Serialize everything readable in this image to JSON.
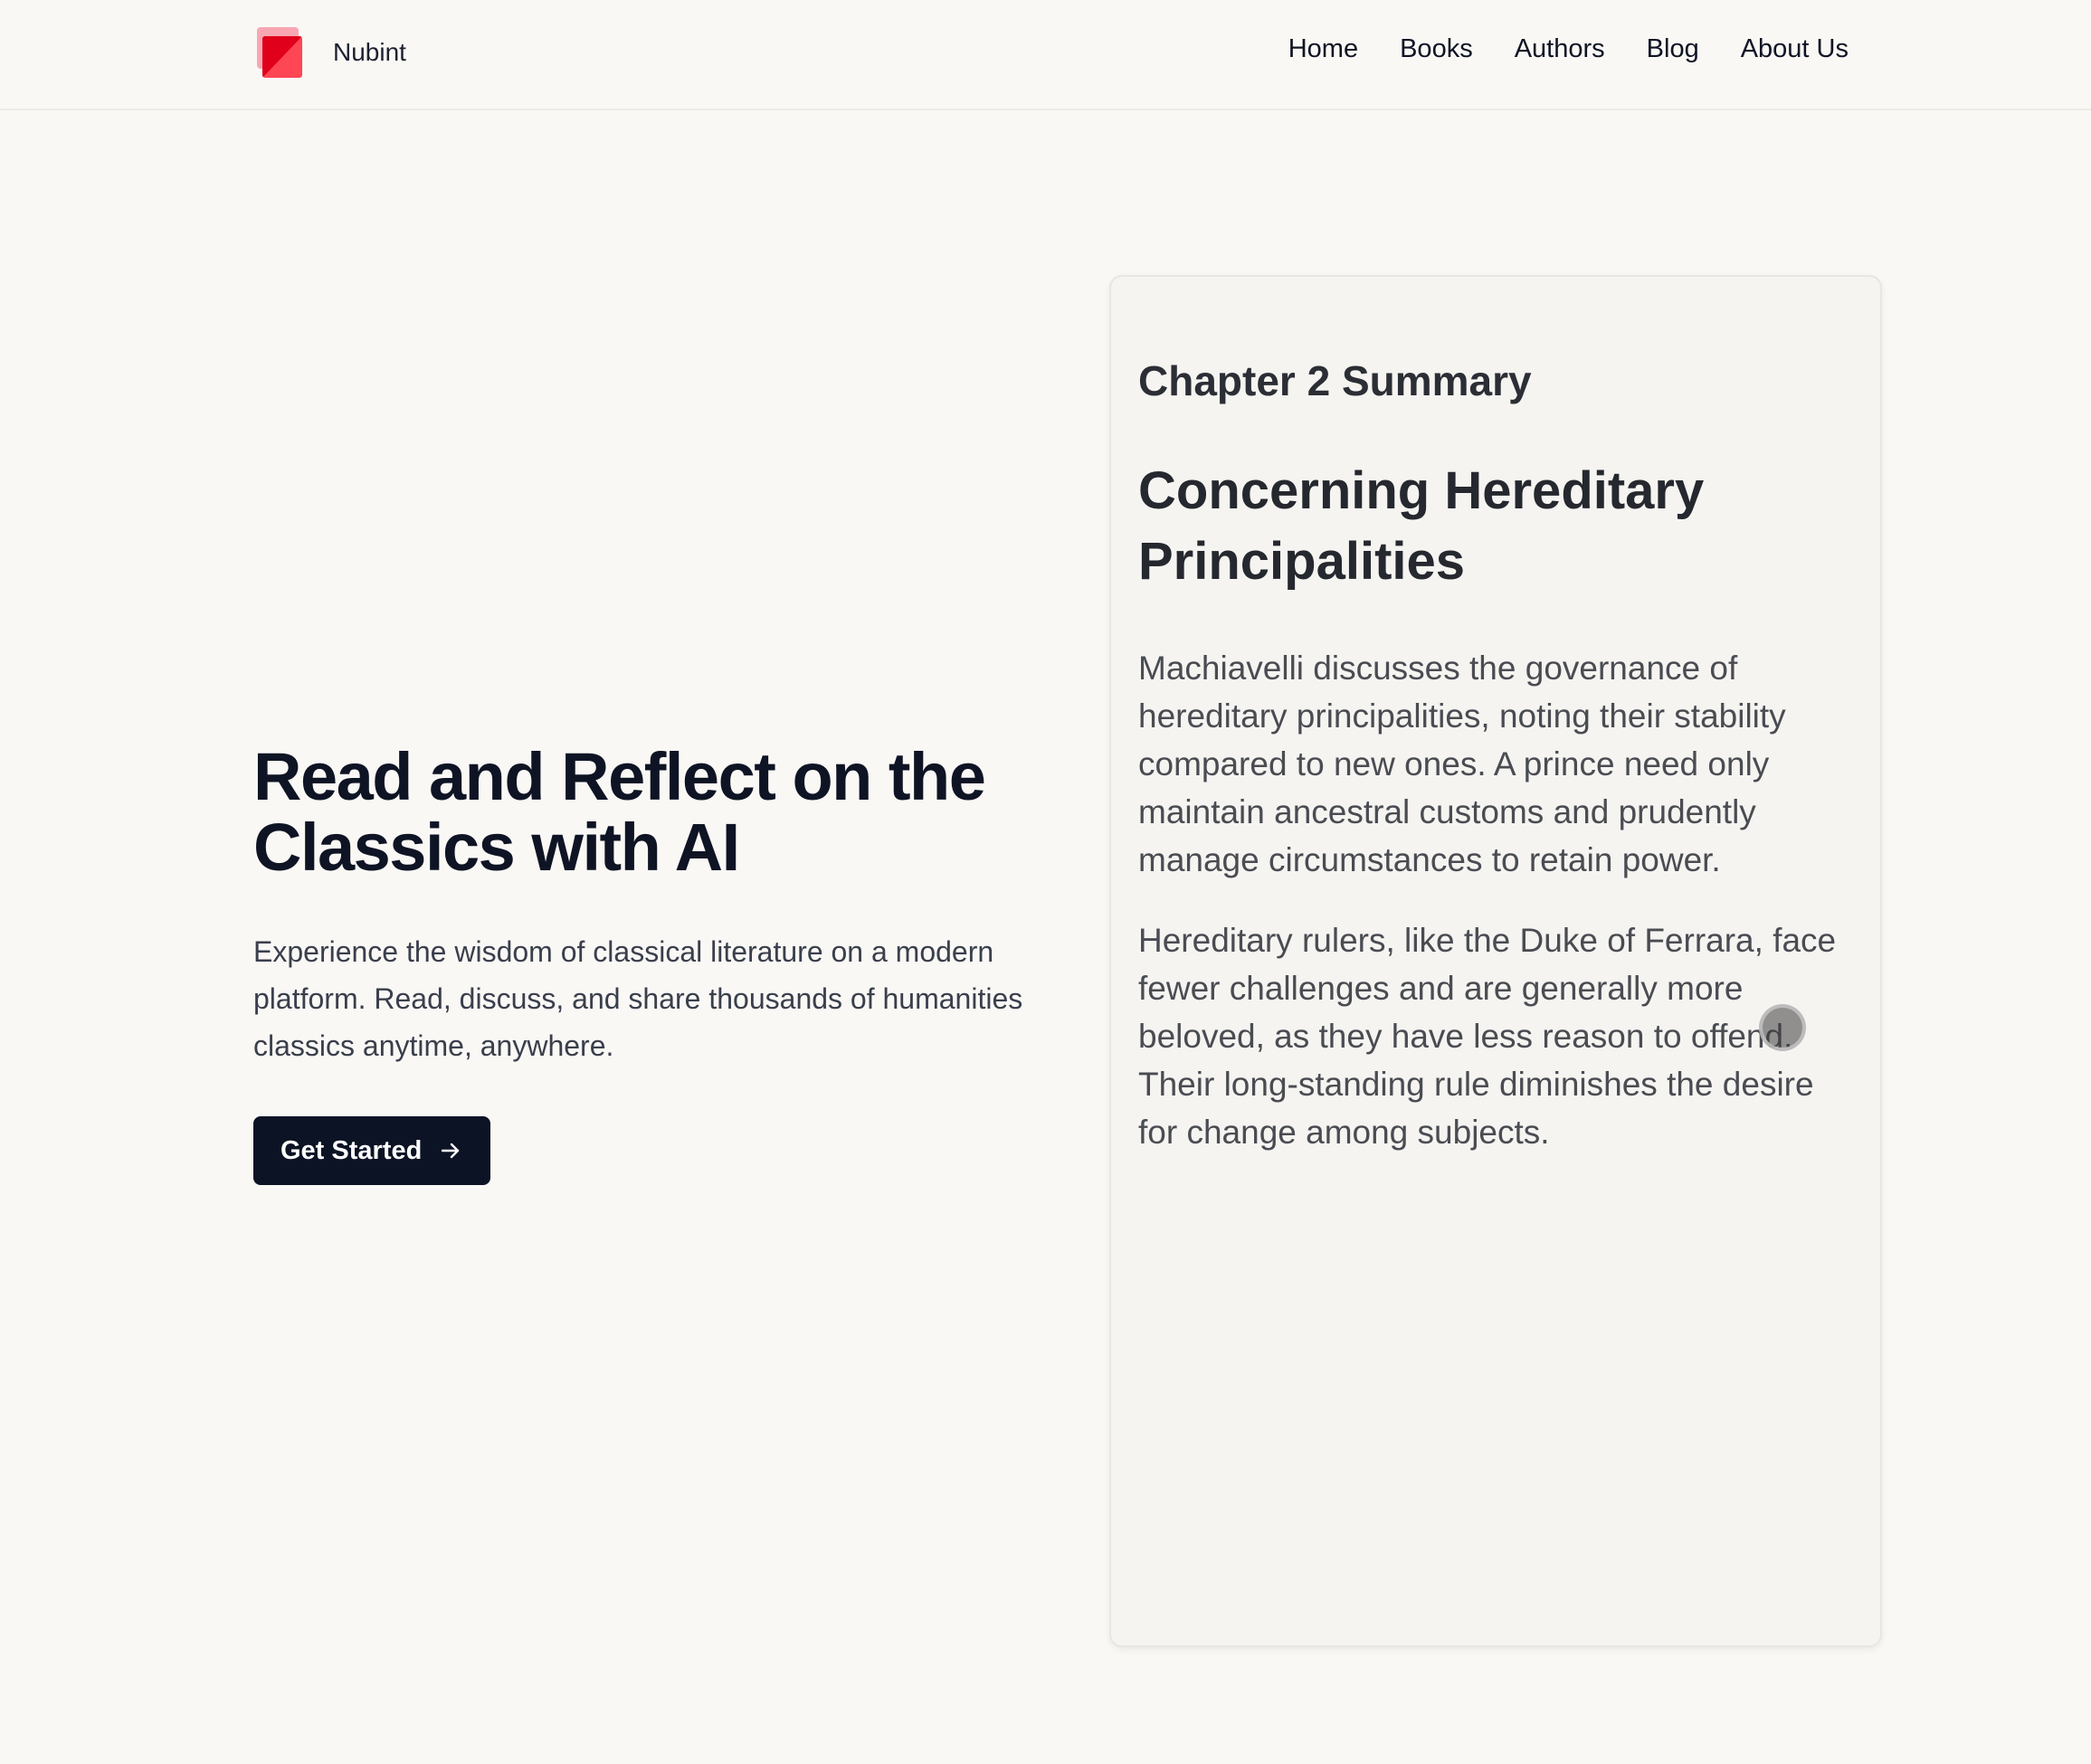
{
  "header": {
    "brand_name": "Nubint",
    "nav": [
      "Home",
      "Books",
      "Authors",
      "Blog",
      "About Us"
    ]
  },
  "hero": {
    "title_line1": "Read and Reflect on the",
    "title_line2": "Classics with AI",
    "description": "Experience the wisdom of classical literature on a modern platform. Read, discuss, and share thousands of humanities classics anytime, anywhere.",
    "cta_label": "Get Started",
    "cta_icon": "arrow-right-icon"
  },
  "summary_card": {
    "eyebrow": "Chapter 2 Summary",
    "title": "Concerning Hereditary Principalities",
    "paragraphs": [
      "Machiavelli discusses the governance of hereditary principalities, noting their stability compared to new ones. A prince need only maintain ancestral customs and prudently manage circumstances to retain power.",
      "Hereditary rulers, like the Duke of Ferrara, face fewer challenges and are generally more beloved, as they have less reason to offend. Their long-standing rule diminishes the desire for change among subjects."
    ]
  },
  "colors": {
    "background": "#faf8f5",
    "button": "#0b1324",
    "logo_accent": "#e0001b"
  }
}
